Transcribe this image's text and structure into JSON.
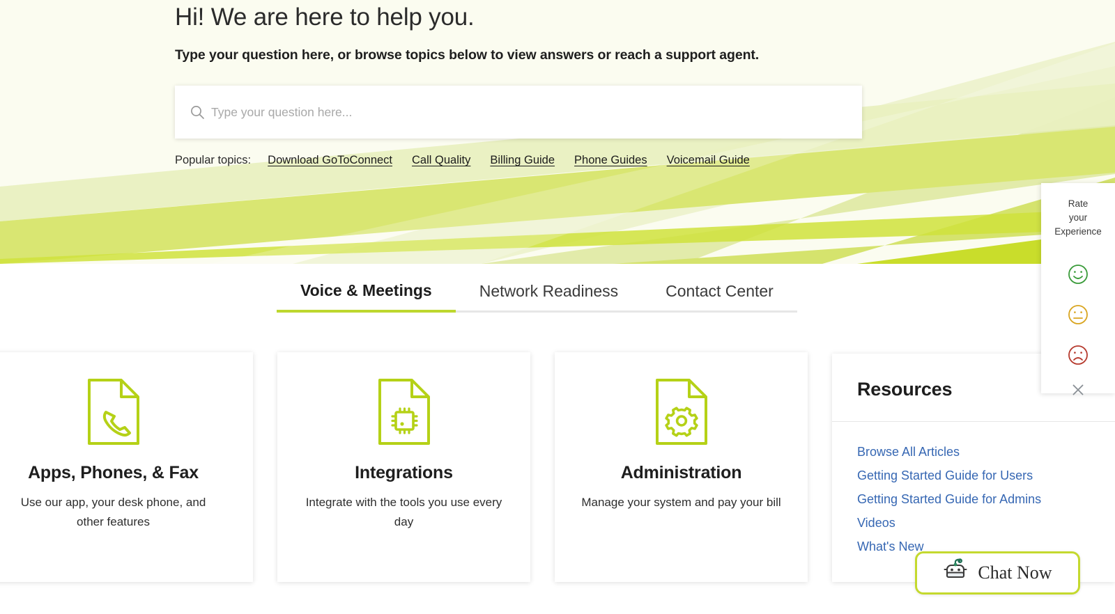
{
  "hero": {
    "title": "Hi! We are here to help you.",
    "subtitle": "Type your question here, or browse topics below to view answers or reach a support agent.",
    "bg_top_color": "#fbfcf0",
    "band_colors": [
      "#f0f4d2",
      "#e4ecae",
      "#d7e574",
      "#cfe03f",
      "#c3d90b"
    ]
  },
  "search": {
    "icon": "search-icon",
    "placeholder": "Type your question here...",
    "value": ""
  },
  "topics": {
    "label": "Popular topics:",
    "links": [
      "Download GoToConnect",
      "Call Quality",
      "Billing Guide",
      "Phone Guides",
      "Voicemail Guide"
    ]
  },
  "tabs": [
    {
      "label": "Voice & Meetings",
      "active": true
    },
    {
      "label": "Network Readiness",
      "active": false
    },
    {
      "label": "Contact Center",
      "active": false
    }
  ],
  "cards": [
    {
      "icon": "document-phone-icon",
      "title": "Apps, Phones, & Fax",
      "description": "Use our app, your desk phone, and other features"
    },
    {
      "icon": "document-chip-icon",
      "title": "Integrations",
      "description": "Integrate with the tools you use every day"
    },
    {
      "icon": "document-gear-icon",
      "title": "Administration",
      "description": "Manage your system and pay your bill"
    }
  ],
  "resources": {
    "title": "Resources",
    "links": [
      "Browse All Articles",
      "Getting Started Guide for Users",
      "Getting Started Guide for Admins",
      "Videos",
      "What's New"
    ],
    "link_color": "#3667b3"
  },
  "rate_widget": {
    "label_line1": "Rate",
    "label_line2": "your",
    "label_line3": "Experience",
    "faces": [
      {
        "name": "happy-face-icon",
        "color": "#3a9b3a"
      },
      {
        "name": "neutral-face-icon",
        "color": "#d9a520"
      },
      {
        "name": "sad-face-icon",
        "color": "#b63a2e"
      }
    ],
    "close_icon": "close-icon",
    "close_color": "#8a9096"
  },
  "chat": {
    "label": "Chat Now",
    "icon": "robot-icon",
    "border_color": "#c4d92e"
  },
  "theme": {
    "accent_green": "#bdd72e",
    "icon_green": "#b5d117",
    "text_dark": "#1e1e1e"
  }
}
